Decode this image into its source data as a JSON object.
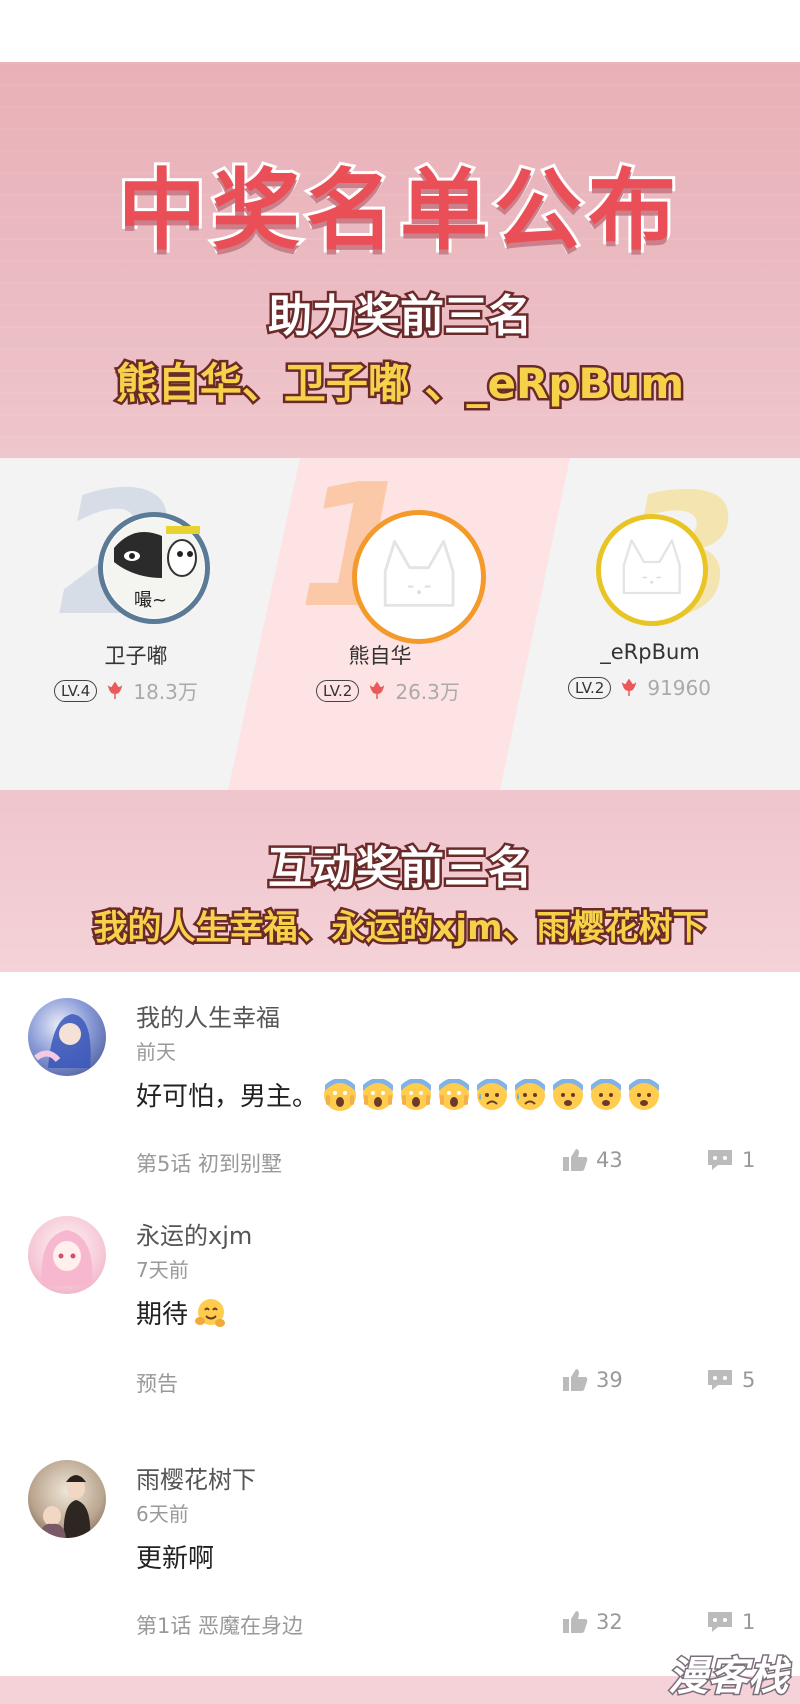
{
  "banner": {
    "title": "中奖名单公布",
    "help_award_heading": "助力奖前三名",
    "help_award_winners": "熊自华、卫子嘟 、_eRpBum"
  },
  "podium": [
    {
      "rank": "2",
      "name": "卫子嘟",
      "level": "LV.4",
      "score": "18.3万"
    },
    {
      "rank": "1",
      "name": "熊自华",
      "level": "LV.2",
      "score": "26.3万"
    },
    {
      "rank": "3",
      "name": "_eRpBum",
      "level": "LV.2",
      "score": "91960"
    }
  ],
  "avatar_caption": "嘬~",
  "banner2": {
    "heading": "互动奖前三名",
    "winners": "我的人生幸福、永运的xjm、雨樱花树下"
  },
  "comments": [
    {
      "user": "我的人生幸福",
      "time": "前天",
      "text": "好可怕，男主。",
      "emojis": [
        "scream",
        "scream",
        "scream",
        "scream",
        "anxious-sweat",
        "anxious-sweat",
        "fearful",
        "fearful",
        "fearful"
      ],
      "chapter": "第5话 初到别墅",
      "likes": "43",
      "replies": "1"
    },
    {
      "user": "永运的xjm",
      "time": "7天前",
      "text": "期待",
      "emojis": [
        "hug"
      ],
      "chapter": "预告",
      "likes": "39",
      "replies": "5"
    },
    {
      "user": "雨樱花树下",
      "time": "6天前",
      "text": "更新啊",
      "emojis": [],
      "chapter": "第1话 恶魔在身边",
      "likes": "32",
      "replies": "1"
    }
  ],
  "watermark": "漫客栈",
  "colors": {
    "title_red": "#ea4f57",
    "rank1_orange": "#f39a2a",
    "rank2_blue": "#d6dde6",
    "rank3_yellow": "#e8c425",
    "banner_pink": "#e9b0b7"
  }
}
